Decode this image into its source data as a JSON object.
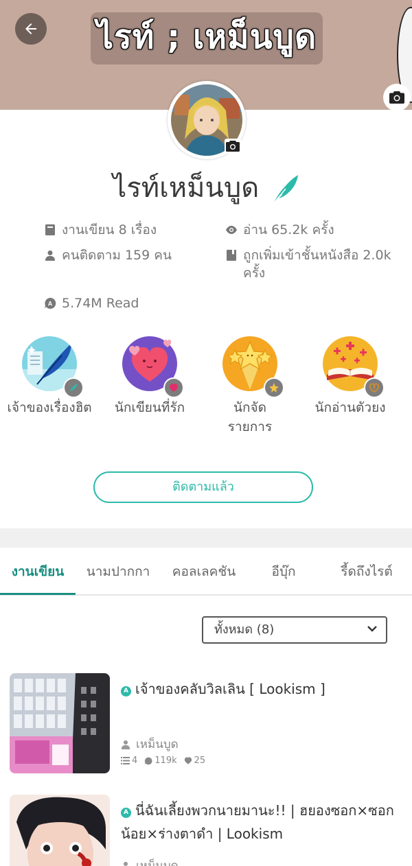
{
  "header": {
    "cover_title": "ไรท์ ; เหม็นบูด",
    "cover_color": "#c4a99c"
  },
  "profile": {
    "name": "ไรท์เหม็นบูด",
    "stats": {
      "works": "งานเขียน 8 เรื่อง",
      "reads": "อ่าน 65.2k ครั้ง",
      "followers": "คนติดตาม 159 คน",
      "library_adds": "ถูกเพิ่มเข้าชั้นหนังสือ 2.0k ครั้ง",
      "total_reads": "5.74M Read"
    },
    "badges": [
      {
        "label": "เจ้าของเรื่องฮิต",
        "icon": "quill-badge-icon"
      },
      {
        "label": "นักเขียนที่รัก",
        "icon": "heart-badge-icon"
      },
      {
        "label": "นักจัดรายการ",
        "icon": "star-badge-icon"
      },
      {
        "label": "นักอ่านตัวยง",
        "icon": "book-badge-icon"
      }
    ],
    "follow_label": "ติดตามแล้ว"
  },
  "tabs": [
    "งานเขียน",
    "นามปากกา",
    "คอลเลคชัน",
    "อีบุ๊ก",
    "รี้ดถึงไรต์"
  ],
  "filter": {
    "selected": "ทั้งหมด (8)"
  },
  "stories": [
    {
      "title": "เจ้าของคลับวิลเลิน [ Lookism ]",
      "author": "เหม็นบูด",
      "chapters": "4",
      "views": "119k",
      "likes": "25"
    },
    {
      "title": "นี่ฉันเลี้ยงพวกนายมานะ!! | ฮยองซอก×ซอกน้อย×ร่างตาดำ | Lookism",
      "author": "เหม็นบูด"
    }
  ],
  "colors": {
    "accent": "#2cbaa9",
    "tab_active": "#1a8f81"
  }
}
